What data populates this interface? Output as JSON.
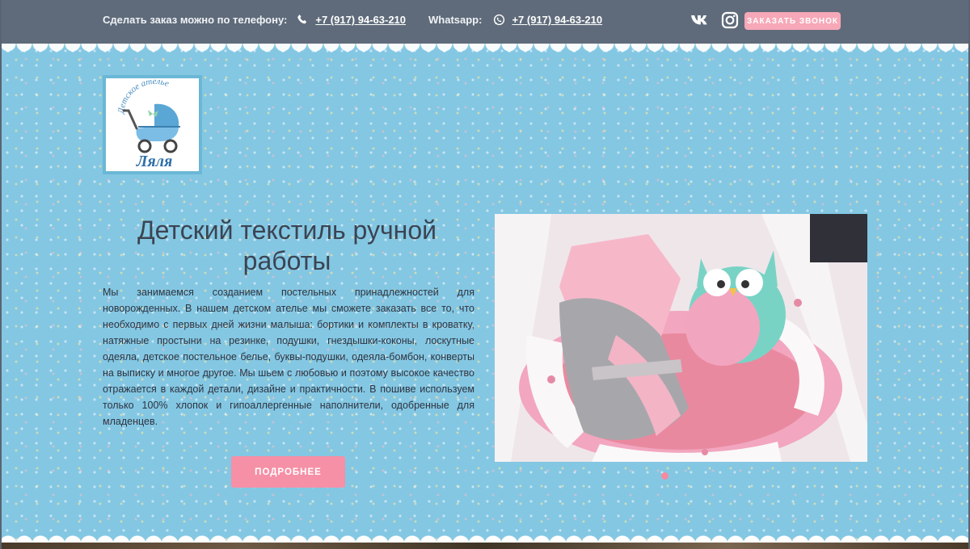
{
  "topbar": {
    "order_phone_label": "Сделать заказ можно по телефону:",
    "order_phone": "+7 (917) 94-63-210",
    "whatsapp_label": "Whatsapp:",
    "whatsapp_phone": "+7 (917) 94-63-210",
    "callback_label": "ЗАКАЗАТЬ ЗВОНОК",
    "vk_label": "vk"
  },
  "logo": {
    "arc_text": "Детское ателье",
    "name": "Ляля"
  },
  "hero": {
    "title": "Детский текстиль ручной работы",
    "description": "Мы занимаемся созданием постельных принадлежностей для новорожденных. В нашем детском ателье мы сможете заказать все то, что необходимо с первых дней жизни малыша: бортики и комплекты в кроватку, натяжные простыни на резинке, подушки, гнездышки-коконы, лоскутные одеяла, детское постельное белье, буквы-подушки, одеяла-бомбон, конверты на выписку и многое другое. Мы шьем с любовью и поэтому высокое качество отражается в каждой детали, дизайне и практичности. В пошиве используем только 100% хлопок и гипоаллергенные наполнители, одобренные для младенцев.",
    "more_label": "ПОДРОБНЕЕ"
  },
  "colors": {
    "topbar_bg": "#5f6b7a",
    "accent_pink": "#f590a6",
    "background_blue": "#84c7e3"
  },
  "icons": [
    "phone-icon",
    "whatsapp-icon",
    "vk-icon",
    "instagram-icon"
  ]
}
